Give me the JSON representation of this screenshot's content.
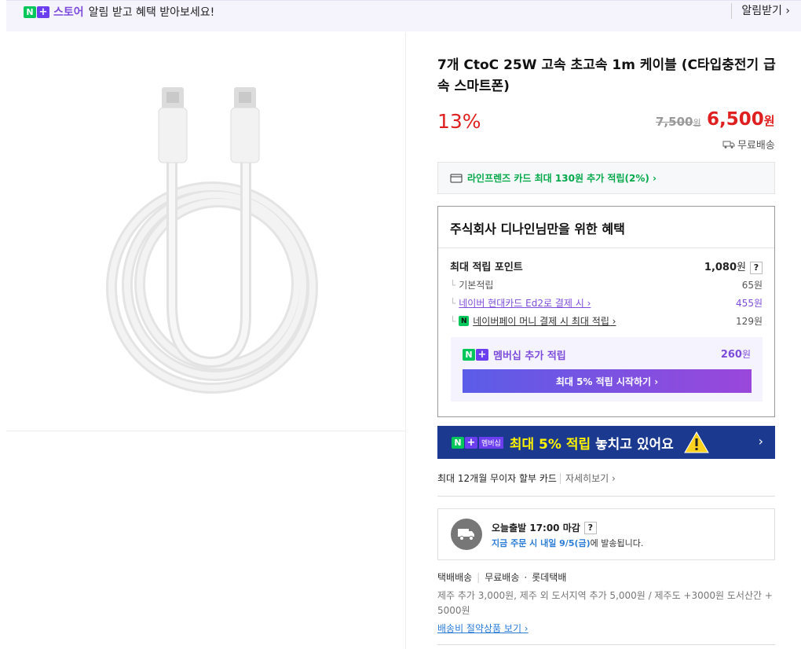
{
  "topbar": {
    "n": "N",
    "plus": "+",
    "store": "스토어",
    "message": "알림 받고 혜택 받아보세요!",
    "alarm_btn": "알림받기 ›"
  },
  "product": {
    "title": "7개 CtoC 25W 고속 초고속 1m 케이블 (C타입충전기 급속 스마트폰)",
    "discount": "13%",
    "original_price": "7,500",
    "original_unit": "원",
    "price": "6,500",
    "price_unit": "원",
    "shipping": "무료배송"
  },
  "card_promo": "라인프렌즈 카드 최대 130원 추가 적립(2%) ›",
  "benefit": {
    "title": "주식회사 디나인님만을 위한 혜택",
    "max_label": "최대 적립 포인트",
    "max_value": "1,080",
    "max_unit": "원",
    "q": "?",
    "rows": [
      {
        "label": "기본적립",
        "value": "65원"
      },
      {
        "label": "네이버 현대카드 Ed2로 결제 시 ›",
        "value": "455원"
      },
      {
        "label": "네이버페이 머니 결제 시 최대 적립 ›",
        "value": "129원"
      }
    ],
    "npay_icon": "N",
    "membership_label": "멤버십 추가 적립",
    "membership_value": "260",
    "membership_unit": "원",
    "membership_btn": "최대 5% 적립 시작하기 ›"
  },
  "banner": {
    "tag": "멤버십",
    "text_pre": "최대 5% 적립",
    "text_post": " 놓치고 있어요",
    "arrow": "›"
  },
  "installment": {
    "text": "최대 12개월 무이자 할부 카드",
    "link": "자세히보기 ›"
  },
  "delivery": {
    "title": "오늘출발 17:00 마감",
    "q": "?",
    "date_text": "지금 주문 시 내일 9/5(금)",
    "suffix": "에 발송됩니다."
  },
  "shipinfo": {
    "type": "택배배송",
    "fee": "무료배송",
    "dot": "·",
    "carrier": "롯데택배",
    "extra": "제주 추가 3,000원, 제주 외 도서지역 추가 5,000원 / 제주도 +3000원 도서산간 + 5000원",
    "link": "배송비 절약상품 보기 ›"
  },
  "colors": {
    "accent": "#e02020",
    "brand_green": "#03c75a",
    "membership_purple": "#7d4cdb",
    "banner_blue": "#1b3a8f"
  },
  "icons": {
    "card": "card-icon",
    "truck": "truck-icon",
    "warning": "warning-icon",
    "question": "question-icon"
  }
}
